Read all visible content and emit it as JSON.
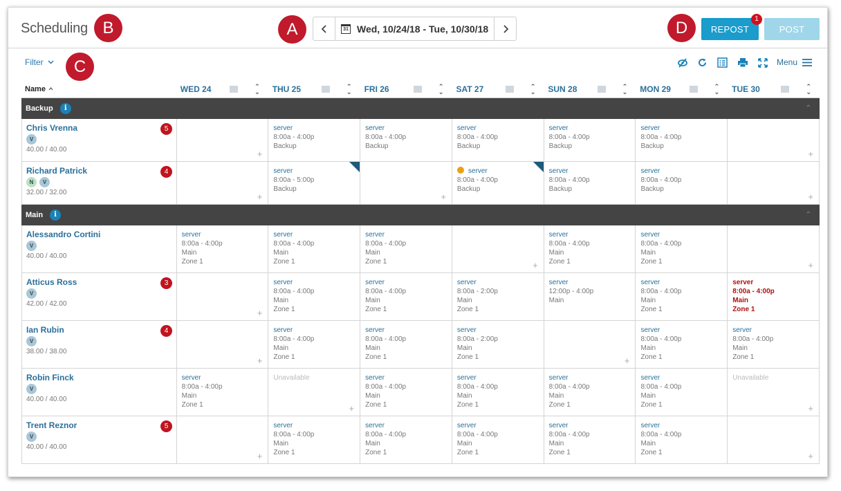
{
  "header": {
    "title": "Scheduling",
    "date_range": "Wed, 10/24/18 - Tue, 10/30/18",
    "calendar_glyph": "31",
    "repost_label": "REPOST",
    "repost_badge": "1",
    "post_label": "POST"
  },
  "markers": {
    "a": "A",
    "b": "B",
    "c": "C",
    "d": "D"
  },
  "toolbar": {
    "filter_label": "Filter",
    "menu_label": "Menu"
  },
  "grid": {
    "name_header": "Name",
    "days": [
      "WED 24",
      "THU 25",
      "FRI 26",
      "SAT 27",
      "SUN 28",
      "MON 29",
      "TUE 30"
    ]
  },
  "sections": [
    {
      "title": "Backup",
      "employees": [
        {
          "name": "Chris Vrenna",
          "badges": [
            "V"
          ],
          "hours": "40.00 / 40.00",
          "count": "5",
          "shifts": [
            null,
            {
              "lines": [
                "server",
                "8:00a - 4:00p",
                "Backup"
              ]
            },
            {
              "lines": [
                "server",
                "8:00a - 4:00p",
                "Backup"
              ]
            },
            {
              "lines": [
                "server",
                "8:00a - 4:00p",
                "Backup"
              ]
            },
            {
              "lines": [
                "server",
                "8:00a - 4:00p",
                "Backup"
              ]
            },
            {
              "lines": [
                "server",
                "8:00a - 4:00p",
                "Backup"
              ]
            },
            null
          ]
        },
        {
          "name": "Richard Patrick",
          "badges": [
            "N",
            "V"
          ],
          "hours": "32.00 / 32.00",
          "count": "4",
          "shifts": [
            null,
            {
              "lines": [
                "server",
                "8:00a - 5:00p",
                "Backup"
              ],
              "flag": true
            },
            null,
            {
              "lines": [
                "server",
                "8:00a - 4:00p",
                "Backup"
              ],
              "flag": true,
              "dot": true
            },
            {
              "lines": [
                "server",
                "8:00a - 4:00p",
                "Backup"
              ]
            },
            {
              "lines": [
                "server",
                "8:00a - 4:00p",
                "Backup"
              ]
            },
            null
          ]
        }
      ]
    },
    {
      "title": "Main",
      "employees": [
        {
          "name": "Alessandro Cortini",
          "badges": [
            "V"
          ],
          "hours": "40.00 / 40.00",
          "count": "",
          "shifts": [
            {
              "lines": [
                "server",
                "8:00a - 4:00p",
                "Main",
                "Zone 1"
              ]
            },
            {
              "lines": [
                "server",
                "8:00a - 4:00p",
                "Main",
                "Zone 1"
              ]
            },
            {
              "lines": [
                "server",
                "8:00a - 4:00p",
                "Main",
                "Zone 1"
              ]
            },
            null,
            {
              "lines": [
                "server",
                "8:00a - 4:00p",
                "Main",
                "Zone 1"
              ]
            },
            {
              "lines": [
                "server",
                "8:00a - 4:00p",
                "Main",
                "Zone 1"
              ]
            },
            null
          ]
        },
        {
          "name": "Atticus Ross",
          "badges": [
            "V"
          ],
          "hours": "42.00 / 42.00",
          "count": "3",
          "shifts": [
            null,
            {
              "lines": [
                "server",
                "8:00a - 4:00p",
                "Main",
                "Zone 1"
              ]
            },
            {
              "lines": [
                "server",
                "8:00a - 4:00p",
                "Main",
                "Zone 1"
              ]
            },
            {
              "lines": [
                "server",
                "8:00a - 2:00p",
                "Main",
                "Zone 1"
              ]
            },
            {
              "lines": [
                "server",
                "12:00p - 4:00p",
                "Main"
              ]
            },
            {
              "lines": [
                "server",
                "8:00a - 4:00p",
                "Main",
                "Zone 1"
              ]
            },
            {
              "lines": [
                "server",
                "8:00a - 4:00p",
                "Main",
                "Zone 1"
              ],
              "red": true
            }
          ]
        },
        {
          "name": "Ian Rubin",
          "badges": [
            "V"
          ],
          "hours": "38.00 / 38.00",
          "count": "4",
          "shifts": [
            null,
            {
              "lines": [
                "server",
                "8:00a - 4:00p",
                "Main",
                "Zone 1"
              ]
            },
            {
              "lines": [
                "server",
                "8:00a - 4:00p",
                "Main",
                "Zone 1"
              ]
            },
            {
              "lines": [
                "server",
                "8:00a - 2:00p",
                "Main",
                "Zone 1"
              ]
            },
            null,
            {
              "lines": [
                "server",
                "8:00a - 4:00p",
                "Main",
                "Zone 1"
              ]
            },
            {
              "lines": [
                "server",
                "8:00a - 4:00p",
                "Main",
                "Zone 1"
              ]
            }
          ]
        },
        {
          "name": "Robin Finck",
          "badges": [
            "V"
          ],
          "hours": "40.00 / 40.00",
          "count": "",
          "shifts": [
            {
              "lines": [
                "server",
                "8:00a - 4:00p",
                "Main",
                "Zone 1"
              ]
            },
            {
              "unavailable": "Unavailable"
            },
            {
              "lines": [
                "server",
                "8:00a - 4:00p",
                "Main",
                "Zone 1"
              ]
            },
            {
              "lines": [
                "server",
                "8:00a - 4:00p",
                "Main",
                "Zone 1"
              ]
            },
            {
              "lines": [
                "server",
                "8:00a - 4:00p",
                "Main",
                "Zone 1"
              ]
            },
            {
              "lines": [
                "server",
                "8:00a - 4:00p",
                "Main",
                "Zone 1"
              ]
            },
            {
              "unavailable": "Unavailable"
            }
          ]
        },
        {
          "name": "Trent Reznor",
          "badges": [
            "V"
          ],
          "hours": "40.00 / 40.00",
          "count": "5",
          "shifts": [
            null,
            {
              "lines": [
                "server",
                "8:00a - 4:00p",
                "Main",
                "Zone 1"
              ]
            },
            {
              "lines": [
                "server",
                "8:00a - 4:00p",
                "Main",
                "Zone 1"
              ]
            },
            {
              "lines": [
                "server",
                "8:00a - 4:00p",
                "Main",
                "Zone 1"
              ]
            },
            {
              "lines": [
                "server",
                "8:00a - 4:00p",
                "Main",
                "Zone 1"
              ]
            },
            {
              "lines": [
                "server",
                "8:00a - 4:00p",
                "Main",
                "Zone 1"
              ]
            },
            null
          ]
        }
      ]
    }
  ],
  "icons": {
    "tools": [
      "hide-icon",
      "refresh-icon",
      "list-view-icon",
      "print-icon",
      "expand-icon"
    ],
    "menu": "hamburger-icon"
  },
  "colors": {
    "accent": "#1a9ccd",
    "section_bar": "#444444",
    "marker": "#c01a2c",
    "link": "#2a6f9a",
    "alert": "#c0141f"
  }
}
